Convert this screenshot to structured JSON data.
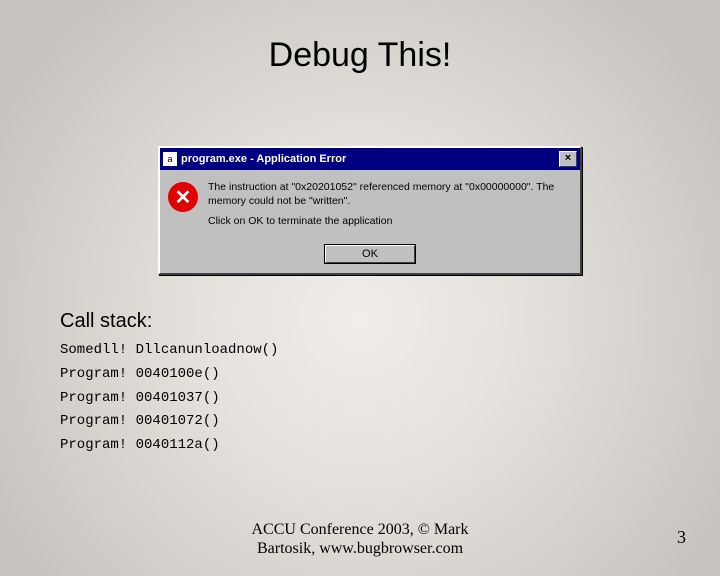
{
  "slide": {
    "title": "Debug This!",
    "number": "3"
  },
  "dialog": {
    "window_title": "program.exe - Application Error",
    "close_label": "×",
    "icon_name": "error-icon",
    "message_line1": "The instruction at \"0x20201052\" referenced memory at \"0x00000000\". The memory could not be \"written\".",
    "message_line2": "Click on OK to terminate the application",
    "ok_label": "OK"
  },
  "callstack": {
    "heading": "Call stack:",
    "lines": [
      "Somedll! Dllcanunloadnow()",
      "Program! 0040100e()",
      "Program! 00401037()",
      "Program! 00401072()",
      "Program! 0040112a()"
    ]
  },
  "footer": {
    "line1": "ACCU Conference 2003, © Mark",
    "line2": "Bartosik, www.bugbrowser.com"
  }
}
